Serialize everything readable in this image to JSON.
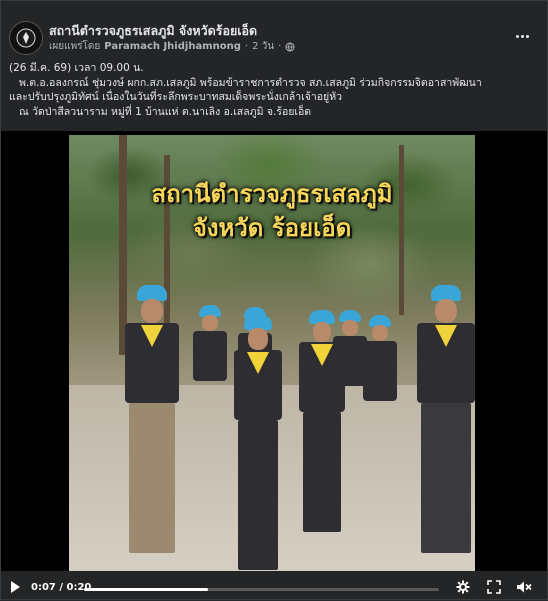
{
  "post": {
    "page_name": "สถานีตำรวจภูธรเสลภูมิ จังหวัดร้อยเอ็ด",
    "published_by_label": "เผยแพร่โดย",
    "author": "Paramach Jhidjhamnong",
    "time_ago": "2 วัน",
    "privacy_icon": "globe-icon",
    "lines": [
      "(26 มี.ค. 69) เวลา 09.00 น.",
      "พ.ต.อ.อลงกรณ์  ชุ่มวงษ์  ผกก.สภ.เสลภูมิ  พร้อมข้าราชการตำรวจ  สภ.เสลภูมิ  ร่วมกิจกรรมจิตอาสาพัฒนา",
      "และปรับปรุงภูมิทัศน์ เนื่องในวันที่ระลึกพระบาทสมเด็จพระนั่งเกล้าเจ้าอยู่หัว",
      "ณ  วัดป่าสีลวนาราม หมู่ที่ 1 บ้านแห่ ต.นาเลิง อ.เสลภูมิ จ.ร้อยเอ็ด"
    ]
  },
  "video": {
    "overlay_title_line1": "สถานีตำรวจภูธรเสลภูมิ",
    "overlay_title_line2": "จังหวัด ร้อยเอ็ด",
    "current_time": "0:07",
    "duration": "0:20",
    "time_separator": "/",
    "progress": 0.35
  },
  "colors": {
    "background": "#242526",
    "text": "#e4e6eb",
    "secondary_text": "#b0b3b8",
    "overlay_title": "#f6d65a",
    "cap": "#3aa6d8",
    "scarf": "#f0d23a"
  }
}
